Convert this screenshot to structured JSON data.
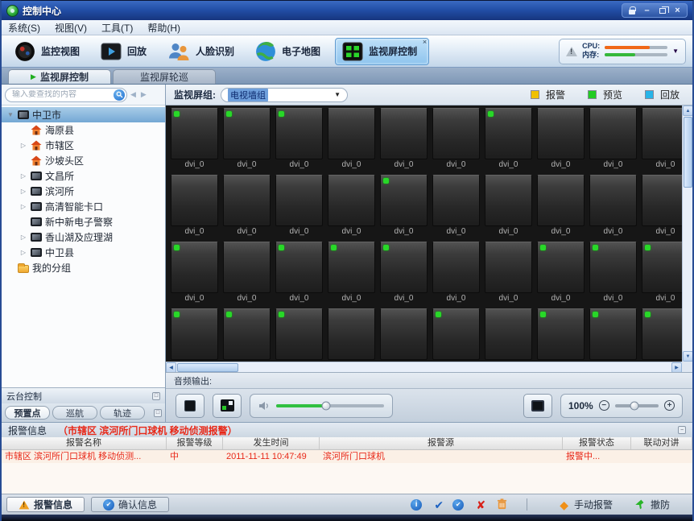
{
  "window": {
    "title": "控制中心"
  },
  "menu": {
    "items": [
      "系统(S)",
      "视图(V)",
      "工具(T)",
      "帮助(H)"
    ]
  },
  "toolbar": {
    "buttons": [
      {
        "id": "monitor-view",
        "label": "监控视图",
        "icon": "camera-lens",
        "active": false
      },
      {
        "id": "playback",
        "label": "回放",
        "icon": "playback",
        "active": false
      },
      {
        "id": "face-recognition",
        "label": "人脸识别",
        "icon": "faces",
        "active": false
      },
      {
        "id": "e-map",
        "label": "电子地图",
        "icon": "globe",
        "active": false
      },
      {
        "id": "screen-control",
        "label": "监视屏控制",
        "icon": "screen-grid",
        "active": true
      }
    ],
    "system": {
      "cpu_label": "CPU:",
      "mem_label": "内存:"
    }
  },
  "tabs": [
    {
      "label": "监视屏控制",
      "active": true
    },
    {
      "label": "监视屏轮巡",
      "active": false
    }
  ],
  "sidebar": {
    "search_placeholder": "输入要查找的内容",
    "tree": [
      {
        "label": "中卫市",
        "icon": "monitor",
        "depth": 0,
        "arrow": "expanded",
        "selected": true
      },
      {
        "label": "海原县",
        "icon": "house",
        "depth": 1,
        "arrow": "none",
        "selected": false
      },
      {
        "label": "市辖区",
        "icon": "house",
        "depth": 1,
        "arrow": "collapsed",
        "selected": false
      },
      {
        "label": "沙坡头区",
        "icon": "house",
        "depth": 1,
        "arrow": "none",
        "selected": false
      },
      {
        "label": "文昌所",
        "icon": "monitor",
        "depth": 1,
        "arrow": "collapsed",
        "selected": false
      },
      {
        "label": "滨河所",
        "icon": "monitor",
        "depth": 1,
        "arrow": "collapsed",
        "selected": false
      },
      {
        "label": "高清智能卡口",
        "icon": "monitor",
        "depth": 1,
        "arrow": "collapsed",
        "selected": false
      },
      {
        "label": "新中新电子警察",
        "icon": "monitor",
        "depth": 1,
        "arrow": "none",
        "selected": false
      },
      {
        "label": "香山湖及应理湖",
        "icon": "monitor",
        "depth": 1,
        "arrow": "collapsed",
        "selected": false
      },
      {
        "label": "中卫县",
        "icon": "monitor",
        "depth": 1,
        "arrow": "collapsed",
        "selected": false
      },
      {
        "label": "我的分组",
        "icon": "folder",
        "depth": 0,
        "arrow": "none",
        "selected": false
      }
    ],
    "ptz": {
      "title": "云台控制",
      "tabs": [
        {
          "label": "预置点",
          "active": true
        },
        {
          "label": "巡航",
          "active": false
        },
        {
          "label": "轨迹",
          "active": false
        }
      ]
    }
  },
  "monitor": {
    "group_label": "监视屏组:",
    "group_value": "电视墙组",
    "legend": [
      {
        "label": "报警",
        "color": "#f0c000"
      },
      {
        "label": "预览",
        "color": "#22cc22"
      },
      {
        "label": "回放",
        "color": "#28b4e8"
      }
    ],
    "grid": {
      "cols": 10,
      "tile_label": "dvi_0",
      "rows": [
        {
          "dots": [
            1,
            2,
            3,
            7
          ],
          "show_labels": true
        },
        {
          "dots": [
            5
          ],
          "show_labels": true
        },
        {
          "dots": [
            1,
            3,
            4,
            5,
            8,
            9,
            10
          ],
          "show_labels": true
        },
        {
          "dots": [
            1,
            2,
            3,
            6,
            8,
            9,
            10
          ],
          "show_labels": false
        }
      ]
    },
    "audio_label": "音频输出:",
    "zoom_value": "100%"
  },
  "alarm": {
    "title": "报警信息",
    "subtitle": "（市辖区 滨河所门口球机 移动侦测报警）",
    "columns": [
      "报警名称",
      "报警等级",
      "发生时间",
      "报警源",
      "报警状态",
      "联动对讲"
    ],
    "rows": [
      {
        "name": "市辖区 滨河所门口球机 移动侦测...",
        "level": "中",
        "time": "2011-11-11 10:47:49",
        "source": "滨河所门口球机",
        "status": "报警中...",
        "intercom": ""
      }
    ]
  },
  "footer": {
    "tabs": [
      {
        "label": "报警信息",
        "icon": "warning",
        "active": true
      },
      {
        "label": "确认信息",
        "icon": "check-circle",
        "active": false
      }
    ],
    "buttons": [
      {
        "label": "手动报警",
        "icon": "alarm-diamond"
      },
      {
        "label": "撤防",
        "icon": "disarm-arrow"
      }
    ]
  }
}
